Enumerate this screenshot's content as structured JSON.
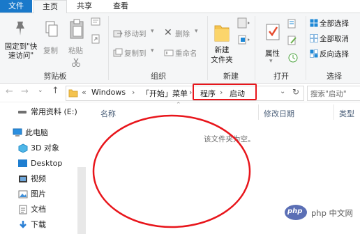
{
  "tabs": {
    "file": "文件",
    "home": "主页",
    "share": "共享",
    "view": "查看"
  },
  "clipboard": {
    "pin_label": "固定到\"快\n速访问\"",
    "copy": "复制",
    "paste": "粘贴",
    "group": "剪贴板"
  },
  "organize": {
    "move_to": "移动到",
    "copy_to": "复制到",
    "delete": "删除",
    "rename": "重命名",
    "group": "组织"
  },
  "new": {
    "new_folder": "新建\n文件夹",
    "group": "新建"
  },
  "open": {
    "properties": "属性",
    "group": "打开"
  },
  "select": {
    "select_all": "全部选择",
    "select_none": "全部取消",
    "invert": "反向选择",
    "group": "选择"
  },
  "address": {
    "chevrons": "«",
    "segments": [
      "Windows",
      "「开始」菜单",
      "程序",
      "启动"
    ],
    "search_placeholder": "搜索\"启动\""
  },
  "navpane": {
    "items": [
      {
        "label": "常用资料 (E:)",
        "icon": "drive-icon"
      },
      {
        "label": "此电脑",
        "icon": "computer-icon"
      },
      {
        "label": "3D 对象",
        "icon": "3d-objects-icon"
      },
      {
        "label": "Desktop",
        "icon": "desktop-icon"
      },
      {
        "label": "视频",
        "icon": "video-icon"
      },
      {
        "label": "图片",
        "icon": "pictures-icon"
      },
      {
        "label": "文档",
        "icon": "documents-icon"
      },
      {
        "label": "下载",
        "icon": "download-icon"
      }
    ]
  },
  "content": {
    "col_name": "名称",
    "col_modified": "修改日期",
    "col_type": "类型",
    "empty_message": "该文件夹为空。"
  },
  "watermark": "php 中文网",
  "colors": {
    "file_tab": "#1979ca",
    "annotation_red": "#e8151b",
    "ribbon_bg": "#f5f6f7"
  }
}
